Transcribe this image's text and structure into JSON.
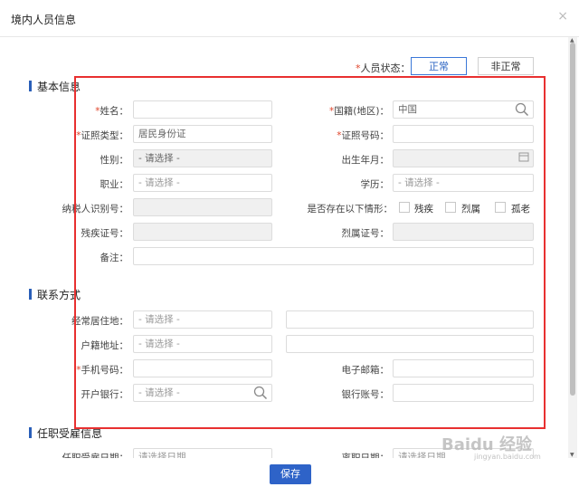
{
  "dialog": {
    "title": "境内人员信息",
    "close_glyph": "×"
  },
  "status": {
    "label": "人员状态：",
    "required_mark": "*",
    "normal": "正常",
    "abnormal": "非正常"
  },
  "sections": {
    "basic": "基本信息",
    "contact": "联系方式",
    "employment": "任职受雇信息"
  },
  "basic": {
    "name_label": "姓名：",
    "nationality_label": "国籍(地区)：",
    "nationality_value": "中国",
    "id_type_label": "证照类型：",
    "id_type_value": "居民身份证",
    "id_number_label": "证照号码：",
    "gender_label": "性别：",
    "gender_value": "- 请选择 -",
    "birth_label": "出生年月：",
    "job_label": "职业：",
    "job_value": "- 请选择 -",
    "education_label": "学历：",
    "education_value": "- 请选择 -",
    "taxid_label": "纳税人识别号：",
    "condition_label": "是否存在以下情形：",
    "condition_options": [
      "残疾",
      "烈属",
      "孤老"
    ],
    "disability_label": "残疾证号：",
    "martyr_label": "烈属证号：",
    "remark_label": "备注："
  },
  "contact": {
    "residence_label": "经常居住地：",
    "residence_value": "- 请选择 -",
    "household_label": "户籍地址：",
    "household_value": "- 请选择 -",
    "mobile_label": "手机号码：",
    "email_label": "电子邮箱：",
    "bank_label": "开户银行：",
    "bank_value": "- 请选择 -",
    "account_label": "银行账号："
  },
  "employment": {
    "hire_date_label": "任职受雇日期：",
    "hire_date_placeholder": "请选择日期",
    "leave_date_label": "离职日期：",
    "leave_date_placeholder": "请选择日期"
  },
  "footer": {
    "save_label": "保存"
  },
  "watermark": {
    "text": "Baidu 经验",
    "sub": "jingyan.baidu.com"
  },
  "colors": {
    "accent": "#2e63c8",
    "required": "#e0452b",
    "highlight": "#e83030"
  }
}
